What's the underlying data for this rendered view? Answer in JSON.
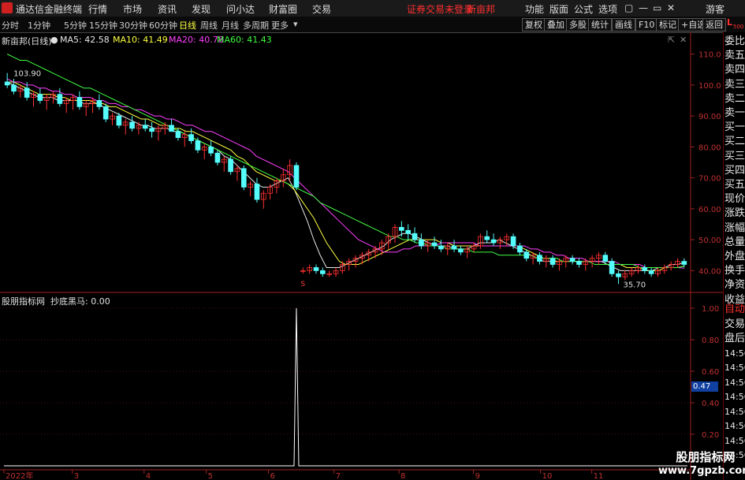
{
  "app": {
    "title": "通达信金融终端"
  },
  "menu": {
    "items": [
      "行情",
      "市场",
      "资讯",
      "发现",
      "问小达",
      "财富圈",
      "交易"
    ],
    "warning": "证券交易未登录",
    "stock_name": "新亩邦",
    "right_items": [
      "功能",
      "版面",
      "公式",
      "选项"
    ],
    "guest": "游客",
    "window_controls": [
      "▢",
      "—",
      "▭",
      "✕"
    ]
  },
  "toolbar": {
    "periods": [
      "分时",
      "1分钟",
      "5分钟",
      "15分钟",
      "30分钟",
      "60分钟",
      "日线",
      "周线",
      "月线",
      "多周期",
      "更多"
    ],
    "active": "日线",
    "buttons": [
      "复权",
      "叠加",
      "多股",
      "统计",
      "画线",
      "F10",
      "标记",
      "+自选",
      "返回"
    ],
    "right_tag_top": "L",
    "right_tag_bottom": "500"
  },
  "main_chart": {
    "title": "新亩邦(日线)",
    "ma": [
      {
        "label": "MA5: 42.58",
        "color": "#e8e8e8"
      },
      {
        "label": "MA10: 41.49",
        "color": "#ffff40"
      },
      {
        "label": "MA20: 40.78",
        "color": "#ff40ff"
      },
      {
        "label": "MA60: 41.43",
        "color": "#40ff40"
      }
    ],
    "high_label": "103.90",
    "low_label": "35.70",
    "yaxis": [
      "110.0",
      "100.0",
      "90.00",
      "80.00",
      "70.00",
      "60.00",
      "50.00",
      "40.00"
    ],
    "marker": "S"
  },
  "sub_chart": {
    "title": "股朋指标网  抄底黑马: 0.00",
    "yaxis": [
      "1.00",
      "0.80",
      "0.60",
      "0.40",
      "0.20"
    ],
    "current_value": "0.47"
  },
  "xaxis": [
    "2022年",
    "3",
    "4",
    "5",
    "6",
    "7",
    "8",
    "9",
    "10",
    "11"
  ],
  "side_panel": {
    "quote_labels": [
      "委比",
      "卖五",
      "卖四",
      "卖三",
      "卖二",
      "卖一",
      "买一",
      "买二",
      "买三",
      "买四",
      "买五",
      "现价",
      "涨跌",
      "涨幅",
      "总量",
      "外盘",
      "换手",
      "净资",
      "收益"
    ],
    "lower_labels": [
      "自动",
      "交易",
      "盘后",
      "14:56",
      "14:56",
      "14:56",
      "14:56",
      "14:56",
      "14:56",
      "14:56",
      "14:56"
    ]
  },
  "watermark": {
    "line1": "股朋指标网",
    "line2": "www.7gpzb.com"
  },
  "chart_data": {
    "type": "candlestick",
    "title": "新亩邦(日线)",
    "ylim": [
      35,
      115
    ],
    "annotations": [
      {
        "label": "103.90",
        "kind": "high"
      },
      {
        "label": "35.70",
        "kind": "low"
      }
    ],
    "candles": [
      [
        101,
        103.9,
        99,
        100
      ],
      [
        100,
        102,
        97,
        98
      ],
      [
        98,
        100,
        96,
        99
      ],
      [
        99,
        101,
        95,
        96
      ],
      [
        96,
        98,
        93,
        97
      ],
      [
        97,
        99,
        94,
        95
      ],
      [
        95,
        97,
        92,
        96
      ],
      [
        96,
        98,
        94,
        97
      ],
      [
        97,
        99,
        93,
        94
      ],
      [
        94,
        96,
        91,
        95
      ],
      [
        95,
        97,
        92,
        96
      ],
      [
        96,
        98,
        92,
        93
      ],
      [
        93,
        95,
        90,
        94
      ],
      [
        94,
        96,
        91,
        95
      ],
      [
        95,
        97,
        92,
        93
      ],
      [
        93,
        94,
        88,
        89
      ],
      [
        89,
        91,
        87,
        90
      ],
      [
        90,
        91,
        86,
        87
      ],
      [
        87,
        89,
        84,
        88
      ],
      [
        88,
        90,
        85,
        86
      ],
      [
        86,
        88,
        84,
        87
      ],
      [
        87,
        89,
        85,
        86
      ],
      [
        86,
        88,
        83,
        85
      ],
      [
        85,
        87,
        82,
        86
      ],
      [
        86,
        88,
        84,
        87
      ],
      [
        87,
        89,
        85,
        85
      ],
      [
        85,
        86,
        82,
        83
      ],
      [
        83,
        85,
        80,
        84
      ],
      [
        84,
        86,
        81,
        82
      ],
      [
        82,
        83,
        78,
        79
      ],
      [
        79,
        81,
        76,
        80
      ],
      [
        80,
        82,
        77,
        78
      ],
      [
        78,
        79,
        74,
        75
      ],
      [
        75,
        77,
        72,
        76
      ],
      [
        76,
        77,
        71,
        72
      ],
      [
        72,
        74,
        69,
        73
      ],
      [
        73,
        74,
        66,
        67
      ],
      [
        67,
        69,
        64,
        68
      ],
      [
        68,
        70,
        62,
        63
      ],
      [
        63,
        66,
        60,
        65
      ],
      [
        65,
        68,
        63,
        67
      ],
      [
        67,
        70,
        65,
        69
      ],
      [
        69,
        73,
        67,
        71
      ],
      [
        71,
        76,
        69,
        74
      ],
      [
        74,
        75,
        66,
        67
      ],
      [
        40,
        41,
        39,
        40
      ],
      [
        40,
        42,
        39,
        41
      ],
      [
        41,
        42,
        39,
        40
      ],
      [
        40,
        41,
        38,
        39
      ],
      [
        39,
        40,
        38,
        39
      ],
      [
        39,
        41,
        38,
        40
      ],
      [
        40,
        43,
        39,
        42
      ],
      [
        42,
        44,
        40,
        43
      ],
      [
        43,
        45,
        41,
        44
      ],
      [
        44,
        46,
        42,
        45
      ],
      [
        45,
        47,
        43,
        46
      ],
      [
        46,
        48,
        44,
        47
      ],
      [
        47,
        50,
        45,
        49
      ],
      [
        49,
        52,
        47,
        51
      ],
      [
        51,
        55,
        49,
        54
      ],
      [
        54,
        56,
        51,
        53
      ],
      [
        53,
        55,
        50,
        52
      ],
      [
        52,
        54,
        49,
        50
      ],
      [
        50,
        52,
        47,
        48
      ],
      [
        48,
        50,
        46,
        49
      ],
      [
        49,
        51,
        47,
        48
      ],
      [
        48,
        50,
        46,
        47
      ],
      [
        47,
        49,
        45,
        48
      ],
      [
        48,
        50,
        46,
        47
      ],
      [
        47,
        48,
        45,
        46
      ],
      [
        46,
        48,
        44,
        47
      ],
      [
        47,
        49,
        46,
        48
      ],
      [
        48,
        52,
        47,
        51
      ],
      [
        51,
        53,
        49,
        50
      ],
      [
        50,
        52,
        48,
        49
      ],
      [
        49,
        51,
        47,
        50
      ],
      [
        50,
        52,
        48,
        51
      ],
      [
        51,
        52,
        47,
        48
      ],
      [
        48,
        49,
        45,
        46
      ],
      [
        46,
        47,
        43,
        44
      ],
      [
        44,
        46,
        42,
        45
      ],
      [
        45,
        46,
        42,
        43
      ],
      [
        43,
        45,
        41,
        44
      ],
      [
        44,
        45,
        41,
        42
      ],
      [
        42,
        44,
        40,
        43
      ],
      [
        43,
        45,
        41,
        44
      ],
      [
        44,
        45,
        42,
        43
      ],
      [
        43,
        44,
        41,
        42
      ],
      [
        42,
        44,
        40,
        43
      ],
      [
        43,
        45,
        41,
        44
      ],
      [
        44,
        46,
        42,
        45
      ],
      [
        45,
        46,
        42,
        43
      ],
      [
        43,
        44,
        38,
        39
      ],
      [
        39,
        40,
        35.7,
        38
      ],
      [
        38,
        40,
        37,
        39
      ],
      [
        39,
        41,
        38,
        40
      ],
      [
        40,
        42,
        39,
        41
      ],
      [
        41,
        42,
        39,
        40
      ],
      [
        40,
        41,
        38,
        39
      ],
      [
        39,
        41,
        38,
        40
      ],
      [
        40,
        42,
        39,
        41
      ],
      [
        41,
        43,
        40,
        42
      ],
      [
        42,
        44,
        41,
        43
      ],
      [
        43,
        44,
        41,
        42
      ]
    ],
    "series": [
      {
        "name": "MA5",
        "values": [
          101,
          100,
          99,
          98,
          97,
          96,
          96,
          96,
          95,
          95,
          95,
          95,
          94,
          94,
          94,
          93,
          92,
          91,
          90,
          89,
          88,
          87,
          87,
          86,
          86,
          86,
          85,
          85,
          84,
          83,
          82,
          81,
          80,
          79,
          77,
          76,
          74,
          72,
          70,
          68,
          67,
          67,
          68,
          69,
          70,
          66,
          61,
          56,
          50,
          45,
          41,
          41,
          41,
          42,
          43,
          44,
          45,
          46,
          47,
          48,
          50,
          51,
          52,
          52,
          51,
          50,
          49,
          48,
          48,
          48,
          47,
          47,
          47,
          48,
          49,
          49,
          49,
          50,
          49,
          48,
          47,
          46,
          45,
          44,
          43,
          43,
          43,
          43,
          43,
          43,
          43,
          43,
          43,
          43,
          42,
          41,
          40,
          40,
          40,
          40,
          40,
          40,
          41,
          41,
          42,
          42,
          42.58
        ]
      },
      {
        "name": "MA10",
        "values": [
          101,
          101,
          100,
          99,
          98,
          97,
          97,
          97,
          96,
          96,
          95,
          95,
          95,
          95,
          94,
          94,
          93,
          93,
          92,
          91,
          90,
          89,
          89,
          88,
          87,
          87,
          86,
          86,
          85,
          85,
          84,
          83,
          82,
          81,
          80,
          79,
          77,
          76,
          74,
          72,
          71,
          70,
          69,
          69,
          68,
          66,
          63,
          60,
          57,
          53,
          49,
          46,
          43,
          42,
          42,
          42,
          43,
          44,
          45,
          46,
          47,
          48,
          49,
          50,
          50,
          50,
          50,
          50,
          49,
          49,
          48,
          48,
          48,
          48,
          48,
          48,
          48,
          48,
          48,
          48,
          48,
          47,
          46,
          45,
          44,
          44,
          43,
          43,
          43,
          43,
          43,
          43,
          43,
          43,
          43,
          42,
          42,
          41,
          41,
          41,
          40,
          40,
          40,
          41,
          41,
          41,
          41.49
        ]
      },
      {
        "name": "MA20",
        "values": [
          102,
          101,
          101,
          100,
          100,
          99,
          99,
          98,
          98,
          97,
          97,
          96,
          96,
          96,
          95,
          95,
          94,
          94,
          93,
          93,
          92,
          92,
          91,
          90,
          90,
          89,
          89,
          88,
          87,
          87,
          86,
          85,
          85,
          84,
          83,
          82,
          81,
          80,
          79,
          77,
          76,
          75,
          74,
          73,
          72,
          70,
          68,
          66,
          64,
          62,
          60,
          58,
          56,
          54,
          52,
          50,
          49,
          48,
          47,
          46,
          46,
          46,
          47,
          47,
          48,
          48,
          48,
          48,
          49,
          49,
          49,
          49,
          49,
          49,
          48,
          48,
          48,
          48,
          48,
          48,
          48,
          48,
          47,
          47,
          46,
          46,
          45,
          45,
          44,
          44,
          44,
          43,
          43,
          43,
          43,
          43,
          42,
          42,
          42,
          42,
          41,
          41,
          41,
          41,
          41,
          41,
          40.78
        ]
      },
      {
        "name": "MA60",
        "values": [
          110,
          109,
          108,
          108,
          107,
          106,
          105,
          104,
          103,
          102,
          101,
          100,
          99,
          99,
          98,
          97,
          96,
          95,
          94,
          93,
          92,
          91,
          90,
          89,
          88,
          87,
          86,
          85,
          84,
          83,
          82,
          81,
          80,
          79,
          78,
          77,
          76,
          75,
          74,
          73,
          72,
          71,
          70,
          69,
          68,
          67,
          66,
          65,
          64,
          62,
          61,
          60,
          59,
          58,
          57,
          56,
          55,
          54,
          53,
          52,
          51,
          51,
          50,
          50,
          49,
          49,
          48,
          48,
          48,
          47,
          47,
          47,
          47,
          46,
          46,
          46,
          46,
          45,
          45,
          45,
          45,
          45,
          45,
          44,
          44,
          44,
          44,
          43,
          43,
          43,
          43,
          43,
          42,
          42,
          42,
          42,
          42,
          42,
          42,
          41,
          41,
          41,
          41,
          41,
          41,
          41,
          41.43
        ]
      }
    ],
    "indicator": {
      "name": "抄底黑马",
      "ylim": [
        0,
        1
      ],
      "signal_index": 44,
      "value": 0.0
    }
  }
}
